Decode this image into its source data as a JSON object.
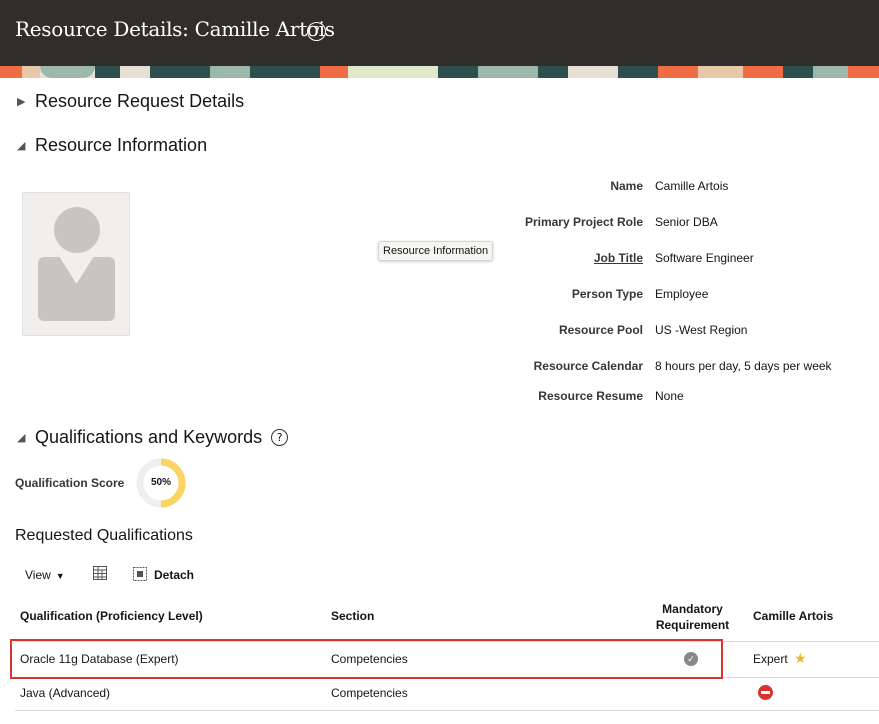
{
  "header": {
    "title": "Resource Details: Camille Artois",
    "help_icon": "question-circle-icon",
    "banner_colors": [
      "#f06c45",
      "#2e4f4b",
      "#e7e0d6",
      "#9bb8a8",
      "#e8c8a8"
    ]
  },
  "sections": {
    "request_details": "Resource Request Details",
    "resource_information": "Resource Information",
    "qualifications": "Qualifications and Keywords"
  },
  "tooltip": "Resource Information",
  "info": [
    {
      "label": "Name",
      "value": "Camille Artois"
    },
    {
      "label": "Primary Project Role",
      "value": "Senior DBA"
    },
    {
      "label": "Job Title",
      "value": "Software Engineer"
    },
    {
      "label": "Person Type",
      "value": "Employee"
    },
    {
      "label": "Resource Pool",
      "value": "US -West Region"
    },
    {
      "label": "Resource Calendar",
      "value": "8 hours per day, 5 days per week"
    },
    {
      "label": "Resource Resume",
      "value": "None"
    }
  ],
  "qualification_score": {
    "label": "Qualification Score",
    "value_text": "50%",
    "value": 50,
    "color": "#fcd466"
  },
  "requested_qualifications": {
    "title": "Requested Qualifications",
    "toolbar": {
      "view": "View",
      "freeze_icon": "freeze-columns-icon",
      "detach_icon": "detach-icon",
      "detach": "Detach"
    },
    "columns": {
      "qualification": "Qualification (Proficiency Level)",
      "section": "Section",
      "mandatory_line1": "Mandatory",
      "mandatory_line2": "Requirement",
      "person": "Camille Artois"
    },
    "rows": [
      {
        "qualification": "Oracle 11g Database (Expert)",
        "section": "Competencies",
        "mandatory": true,
        "match": "Expert",
        "match_icon": "star-icon"
      },
      {
        "qualification": "Java (Advanced)",
        "section": "Competencies",
        "mandatory": false,
        "match": "",
        "match_icon": "no-entry-icon"
      }
    ]
  },
  "colors": {
    "accent_red": "#d9352e",
    "star": "#f0b429",
    "header_bg": "#312d2a"
  }
}
